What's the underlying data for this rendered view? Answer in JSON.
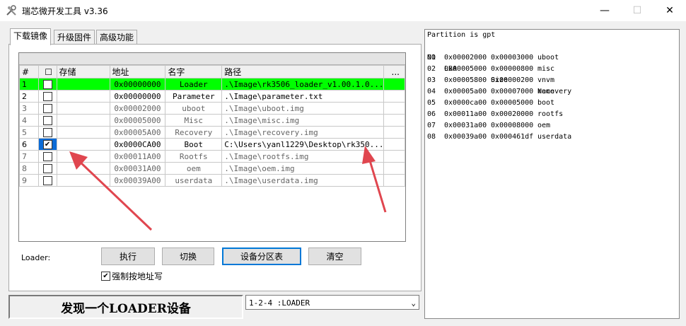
{
  "window": {
    "title": "瑞芯微开发工具 v3.36"
  },
  "tabs": [
    {
      "label": "下载镜像"
    },
    {
      "label": "升级固件"
    },
    {
      "label": "高级功能"
    }
  ],
  "grid": {
    "headers": {
      "num": "#",
      "check": "☐",
      "store": "存储",
      "addr": "地址",
      "name": "名字",
      "path": "路径",
      "more": "..."
    },
    "rows": [
      {
        "num": "1",
        "checked": false,
        "addr": "0x00000000",
        "name": "Loader",
        "path": ".\\Image\\rk3506_loader_v1.00.1.0..."
      },
      {
        "num": "2",
        "checked": false,
        "addr": "0x00000000",
        "name": "Parameter",
        "path": ".\\Image\\parameter.txt"
      },
      {
        "num": "3",
        "checked": false,
        "addr": "0x00002000",
        "name": "uboot",
        "path": ".\\Image\\uboot.img"
      },
      {
        "num": "4",
        "checked": false,
        "addr": "0x00005000",
        "name": "Misc",
        "path": ".\\Image\\misc.img"
      },
      {
        "num": "5",
        "checked": false,
        "addr": "0x00005A00",
        "name": "Recovery",
        "path": ".\\Image\\recovery.img"
      },
      {
        "num": "6",
        "checked": true,
        "addr": "0x0000CA00",
        "name": "Boot",
        "path": "C:\\Users\\yanl1229\\Desktop\\rk350..."
      },
      {
        "num": "7",
        "checked": false,
        "addr": "0x00011A00",
        "name": "Rootfs",
        "path": ".\\Image\\rootfs.img"
      },
      {
        "num": "8",
        "checked": false,
        "addr": "0x00031A00",
        "name": "oem",
        "path": ".\\Image\\oem.img"
      },
      {
        "num": "9",
        "checked": false,
        "addr": "0x00039A00",
        "name": "userdata",
        "path": ".\\Image\\userdata.img"
      }
    ]
  },
  "controls": {
    "loader_label": "Loader:",
    "execute": "执行",
    "switch": "切换",
    "partition_table": "设备分区表",
    "clear": "清空",
    "force_addr": "强制按地址写",
    "force_checked": true
  },
  "status": {
    "text": "发现一个LOADER设备"
  },
  "device_combo": {
    "value": "1-2-4 :LOADER"
  },
  "partition": {
    "title": "Partition is gpt",
    "header": {
      "no": "NO",
      "lba": "LBA",
      "size": "Size",
      "name": "Name"
    },
    "rows": [
      {
        "no": "01",
        "lba": "0x00002000",
        "size": "0x00003000",
        "name": "uboot"
      },
      {
        "no": "02",
        "lba": "0x00005000",
        "size": "0x00000800",
        "name": "misc"
      },
      {
        "no": "03",
        "lba": "0x00005800",
        "size": "0x00000200",
        "name": "vnvm"
      },
      {
        "no": "04",
        "lba": "0x00005a00",
        "size": "0x00007000",
        "name": "recovery"
      },
      {
        "no": "05",
        "lba": "0x0000ca00",
        "size": "0x00005000",
        "name": "boot"
      },
      {
        "no": "06",
        "lba": "0x00011a00",
        "size": "0x00020000",
        "name": "rootfs"
      },
      {
        "no": "07",
        "lba": "0x00031a00",
        "size": "0x00008000",
        "name": "oem"
      },
      {
        "no": "08",
        "lba": "0x00039a00",
        "size": "0x000461df",
        "name": "userdata"
      }
    ]
  },
  "colors": {
    "highlight": "#00ff00",
    "annotation": "#e0464f",
    "selected": "#0b6bd6"
  }
}
